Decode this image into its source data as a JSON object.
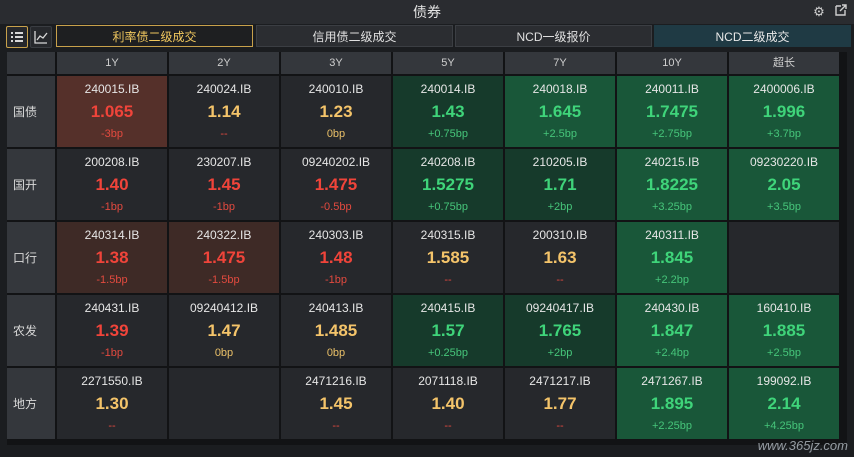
{
  "window": {
    "title": "债券"
  },
  "tabs": [
    "利率债二级成交",
    "信用债二级成交",
    "NCD一级报价",
    "NCD二级成交"
  ],
  "tenors": [
    "1Y",
    "2Y",
    "3Y",
    "5Y",
    "7Y",
    "10Y",
    "超长"
  ],
  "rows": [
    {
      "name": "国债",
      "cells": [
        {
          "code": "240015.IB",
          "yield": "1.065",
          "chg": "-3bp"
        },
        {
          "code": "240024.IB",
          "yield": "1.14",
          "chg": "--"
        },
        {
          "code": "240010.IB",
          "yield": "1.23",
          "chg": "0bp"
        },
        {
          "code": "240014.IB",
          "yield": "1.43",
          "chg": "+0.75bp"
        },
        {
          "code": "240018.IB",
          "yield": "1.645",
          "chg": "+2.5bp"
        },
        {
          "code": "240011.IB",
          "yield": "1.7475",
          "chg": "+2.75bp"
        },
        {
          "code": "2400006.IB",
          "yield": "1.996",
          "chg": "+3.7bp"
        }
      ]
    },
    {
      "name": "国开",
      "cells": [
        {
          "code": "200208.IB",
          "yield": "1.40",
          "chg": "-1bp"
        },
        {
          "code": "230207.IB",
          "yield": "1.45",
          "chg": "-1bp"
        },
        {
          "code": "09240202.IB",
          "yield": "1.475",
          "chg": "-0.5bp"
        },
        {
          "code": "240208.IB",
          "yield": "1.5275",
          "chg": "+0.75bp"
        },
        {
          "code": "210205.IB",
          "yield": "1.71",
          "chg": "+2bp"
        },
        {
          "code": "240215.IB",
          "yield": "1.8225",
          "chg": "+3.25bp"
        },
        {
          "code": "09230220.IB",
          "yield": "2.05",
          "chg": "+3.5bp"
        }
      ]
    },
    {
      "name": "口行",
      "cells": [
        {
          "code": "240314.IB",
          "yield": "1.38",
          "chg": "-1.5bp"
        },
        {
          "code": "240322.IB",
          "yield": "1.475",
          "chg": "-1.5bp"
        },
        {
          "code": "240303.IB",
          "yield": "1.48",
          "chg": "-1bp"
        },
        {
          "code": "240315.IB",
          "yield": "1.585",
          "chg": "--"
        },
        {
          "code": "200310.IB",
          "yield": "1.63",
          "chg": "--"
        },
        {
          "code": "240311.IB",
          "yield": "1.845",
          "chg": "+2.2bp"
        },
        {
          "code": "",
          "yield": "",
          "chg": ""
        }
      ]
    },
    {
      "name": "农发",
      "cells": [
        {
          "code": "240431.IB",
          "yield": "1.39",
          "chg": "-1bp"
        },
        {
          "code": "09240412.IB",
          "yield": "1.47",
          "chg": "0bp"
        },
        {
          "code": "240413.IB",
          "yield": "1.485",
          "chg": "0bp"
        },
        {
          "code": "240415.IB",
          "yield": "1.57",
          "chg": "+0.25bp"
        },
        {
          "code": "09240417.IB",
          "yield": "1.765",
          "chg": "+2bp"
        },
        {
          "code": "240430.IB",
          "yield": "1.847",
          "chg": "+2.4bp"
        },
        {
          "code": "160410.IB",
          "yield": "1.885",
          "chg": "+2.5bp"
        }
      ]
    },
    {
      "name": "地方",
      "cells": [
        {
          "code": "2271550.IB",
          "yield": "1.30",
          "chg": "--"
        },
        {
          "code": "",
          "yield": "",
          "chg": ""
        },
        {
          "code": "2471216.IB",
          "yield": "1.45",
          "chg": "--"
        },
        {
          "code": "2071118.IB",
          "yield": "1.40",
          "chg": "--"
        },
        {
          "code": "2471217.IB",
          "yield": "1.77",
          "chg": "--"
        },
        {
          "code": "2471267.IB",
          "yield": "1.895",
          "chg": "+2.25bp"
        },
        {
          "code": "199092.IB",
          "yield": "2.14",
          "chg": "+4.25bp"
        }
      ]
    }
  ],
  "cell_styles": [
    [
      "red-strong",
      "plain",
      "plain",
      "green",
      "green-strong",
      "green-strong",
      "green-strong"
    ],
    [
      "plain",
      "plain",
      "plain",
      "green",
      "green",
      "green-strong",
      "green-strong"
    ],
    [
      "red",
      "red",
      "plain",
      "plain",
      "plain",
      "green-strong",
      "plain"
    ],
    [
      "plain",
      "plain",
      "plain",
      "green",
      "green",
      "green-strong",
      "green-strong"
    ],
    [
      "plain",
      "plain",
      "plain",
      "plain",
      "plain",
      "green-strong",
      "green-strong"
    ]
  ],
  "yield_colors": [
    [
      "red",
      "yellow",
      "yellow",
      "green",
      "green",
      "green",
      "green"
    ],
    [
      "red",
      "red",
      "red",
      "green",
      "green",
      "green",
      "green"
    ],
    [
      "red",
      "red",
      "red",
      "yellow",
      "yellow",
      "green",
      "green"
    ],
    [
      "red",
      "yellow",
      "yellow",
      "green",
      "green",
      "green",
      "green"
    ],
    [
      "yellow",
      "yellow",
      "yellow",
      "yellow",
      "yellow",
      "green",
      "green"
    ]
  ],
  "colors": {
    "accent": "#c8a14b",
    "up": "#3fd47a",
    "down": "#f0443a",
    "flat": "#f4c46a",
    "selected_tab": "#1f3a44"
  },
  "icons": {
    "settings": "gear-icon",
    "popout": "external-link-icon",
    "list_view": "list-icon",
    "chart_view": "line-chart-icon"
  },
  "watermark": "www.365jz.com"
}
